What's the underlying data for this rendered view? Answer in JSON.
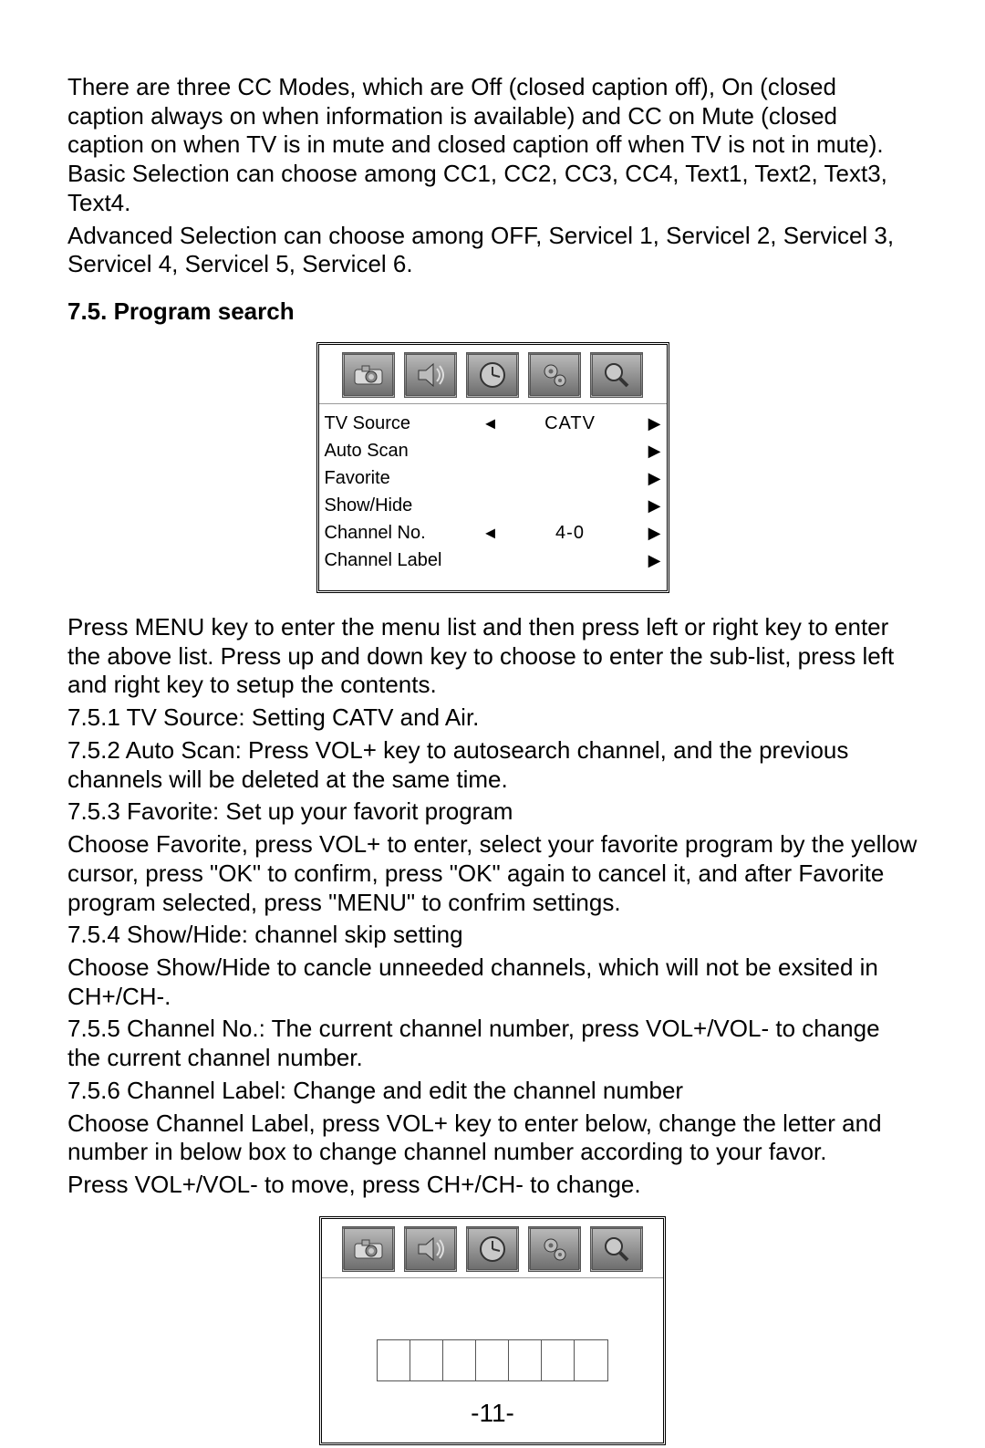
{
  "paragraphs": {
    "p1": "There are three CC Modes, which are Off (closed caption off), On (closed caption always on when information is available) and CC on Mute (closed caption on when TV is in mute and closed caption off when TV is not in mute). Basic Selection can choose among CC1, CC2, CC3, CC4, Text1, Text2, Text3, Text4.",
    "p2": "Advanced Selection can choose among OFF, Servicel 1, Servicel 2, Servicel 3, Servicel 4, Servicel 5, Servicel 6."
  },
  "section_heading": "7.5. Program search",
  "menu1": {
    "icons": [
      "camera-icon",
      "speaker-icon",
      "clock-icon",
      "gear-icon",
      "magnifier-icon"
    ],
    "rows": [
      {
        "label": "TV Source",
        "left": "◄",
        "value": "CATV",
        "right": "▶"
      },
      {
        "label": "Auto Scan",
        "left": "",
        "value": "",
        "right": "▶"
      },
      {
        "label": "Favorite",
        "left": "",
        "value": "",
        "right": "▶"
      },
      {
        "label": "Show/Hide",
        "left": "",
        "value": "",
        "right": "▶"
      },
      {
        "label": "Channel No.",
        "left": "◄",
        "value": "4-0",
        "right": "▶"
      },
      {
        "label": "Channel Label",
        "left": "",
        "value": "",
        "right": "▶"
      }
    ]
  },
  "instructions": {
    "i1": "Press MENU key to enter the menu list and then press left or right key to enter the above list. Press up and down key to choose to enter the sub-list, press left and right key to setup the contents.",
    "i2": "7.5.1 TV Source: Setting CATV and Air.",
    "i3": "7.5.2 Auto Scan: Press VOL+ key to autosearch channel, and the previous channels will be deleted at the same time.",
    "i4": "7.5.3 Favorite: Set up your favorit program",
    "i5": "Choose Favorite, press VOL+ to enter, select your favorite program by the yellow cursor, press \"OK\" to confirm, press \"OK\" again to cancel it, and after Favorite program selected, press \"MENU\" to confrim settings.",
    "i6": "7.5.4 Show/Hide: channel skip setting",
    "i7": "Choose Show/Hide to cancle unneeded channels, which will not be exsited in CH+/CH-.",
    "i8": "7.5.5 Channel No.: The current channel number, press VOL+/VOL- to change the current channel number.",
    "i9": "7.5.6 Channel Label: Change and edit the channel number",
    "i10": "Choose Channel Label, press VOL+ key to enter below, change the letter and number in below box to change channel number according to your favor.",
    "i11": "Press VOL+/VOL- to move, press CH+/CH- to change."
  },
  "menu2": {
    "icons": [
      "camera-icon",
      "speaker-icon",
      "clock-icon",
      "gear-icon",
      "magnifier-icon"
    ],
    "char_count": 7
  },
  "page_number": "-11-"
}
